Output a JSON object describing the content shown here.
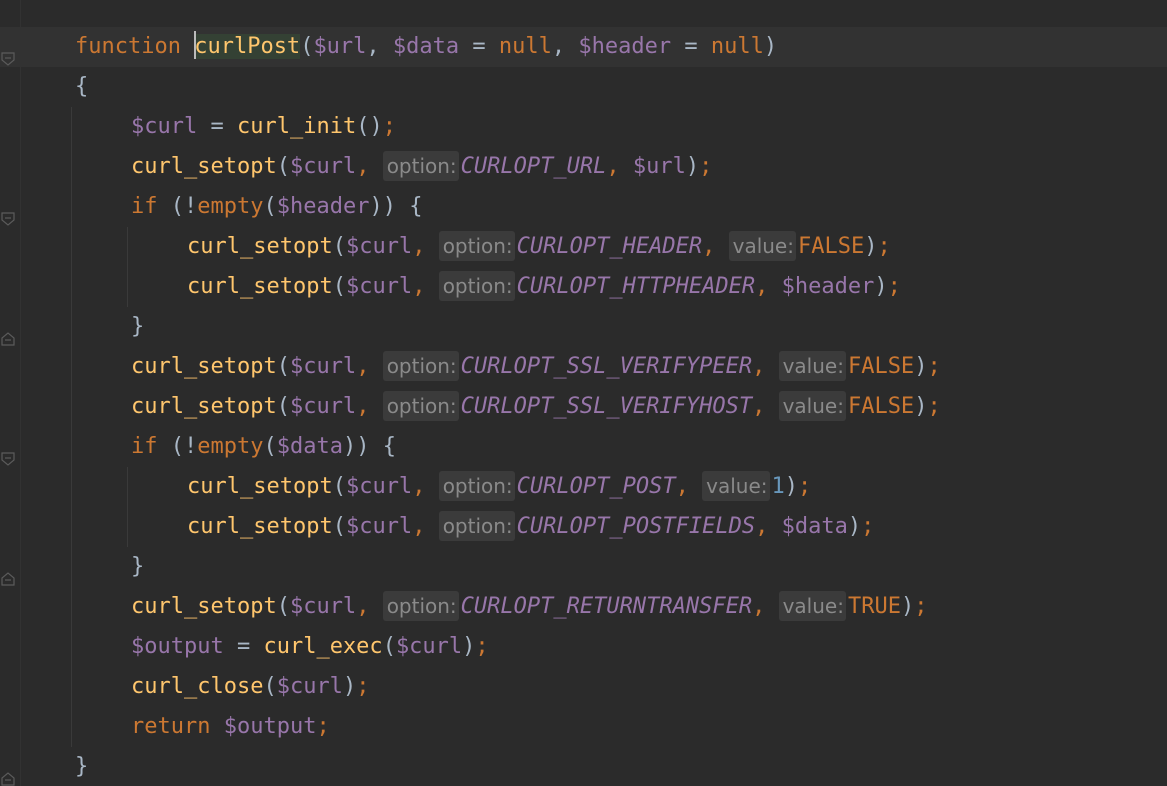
{
  "editor": {
    "lines": [
      {
        "indent": 0,
        "current": true,
        "tokens": [
          {
            "t": "kw",
            "v": "function "
          },
          {
            "t": "caret"
          },
          {
            "t": "fn",
            "v": "curlPost",
            "cls": "caret-word"
          },
          {
            "t": "txt",
            "v": "("
          },
          {
            "t": "var",
            "v": "$url"
          },
          {
            "t": "txt",
            "v": ", "
          },
          {
            "t": "var",
            "v": "$data"
          },
          {
            "t": "txt",
            "v": " = "
          },
          {
            "t": "kw",
            "v": "null"
          },
          {
            "t": "txt",
            "v": ", "
          },
          {
            "t": "var",
            "v": "$header"
          },
          {
            "t": "txt",
            "v": " = "
          },
          {
            "t": "kw",
            "v": "null"
          },
          {
            "t": "txt",
            "v": ")"
          }
        ]
      },
      {
        "indent": 0,
        "tokens": [
          {
            "t": "txt",
            "v": "{"
          }
        ]
      },
      {
        "indent": 1,
        "tokens": [
          {
            "t": "var",
            "v": "$curl"
          },
          {
            "t": "txt",
            "v": " = "
          },
          {
            "t": "fn",
            "v": "curl_init"
          },
          {
            "t": "txt",
            "v": "()"
          },
          {
            "t": "kw",
            "v": ";"
          }
        ]
      },
      {
        "indent": 1,
        "tokens": [
          {
            "t": "fn",
            "v": "curl_setopt"
          },
          {
            "t": "txt",
            "v": "("
          },
          {
            "t": "var",
            "v": "$curl"
          },
          {
            "t": "kw",
            "v": ", "
          },
          {
            "t": "hint",
            "v": "option:"
          },
          {
            "t": "const",
            "v": "CURLOPT_URL"
          },
          {
            "t": "kw",
            "v": ", "
          },
          {
            "t": "var",
            "v": "$url"
          },
          {
            "t": "txt",
            "v": ")"
          },
          {
            "t": "kw",
            "v": ";"
          }
        ]
      },
      {
        "indent": 1,
        "tokens": [
          {
            "t": "kw",
            "v": "if "
          },
          {
            "t": "txt",
            "v": "(!"
          },
          {
            "t": "kw",
            "v": "empty"
          },
          {
            "t": "txt",
            "v": "("
          },
          {
            "t": "var",
            "v": "$header"
          },
          {
            "t": "txt",
            "v": ")) {"
          }
        ]
      },
      {
        "indent": 2,
        "tokens": [
          {
            "t": "fn",
            "v": "curl_setopt"
          },
          {
            "t": "txt",
            "v": "("
          },
          {
            "t": "var",
            "v": "$curl"
          },
          {
            "t": "kw",
            "v": ", "
          },
          {
            "t": "hint",
            "v": "option:"
          },
          {
            "t": "const",
            "v": "CURLOPT_HEADER"
          },
          {
            "t": "kw",
            "v": ", "
          },
          {
            "t": "hint",
            "v": "value:"
          },
          {
            "t": "kw",
            "v": "FALSE"
          },
          {
            "t": "txt",
            "v": ")"
          },
          {
            "t": "kw",
            "v": ";"
          }
        ]
      },
      {
        "indent": 2,
        "tokens": [
          {
            "t": "fn",
            "v": "curl_setopt"
          },
          {
            "t": "txt",
            "v": "("
          },
          {
            "t": "var",
            "v": "$curl"
          },
          {
            "t": "kw",
            "v": ", "
          },
          {
            "t": "hint",
            "v": "option:"
          },
          {
            "t": "const",
            "v": "CURLOPT_HTTPHEADER"
          },
          {
            "t": "kw",
            "v": ", "
          },
          {
            "t": "var",
            "v": "$header"
          },
          {
            "t": "txt",
            "v": ")"
          },
          {
            "t": "kw",
            "v": ";"
          }
        ]
      },
      {
        "indent": 1,
        "tokens": [
          {
            "t": "txt",
            "v": "}"
          }
        ]
      },
      {
        "indent": 1,
        "tokens": [
          {
            "t": "fn",
            "v": "curl_setopt"
          },
          {
            "t": "txt",
            "v": "("
          },
          {
            "t": "var",
            "v": "$curl"
          },
          {
            "t": "kw",
            "v": ", "
          },
          {
            "t": "hint",
            "v": "option:"
          },
          {
            "t": "const",
            "v": "CURLOPT_SSL_VERIFYPEER"
          },
          {
            "t": "kw",
            "v": ", "
          },
          {
            "t": "hint",
            "v": "value:"
          },
          {
            "t": "kw",
            "v": "FALSE"
          },
          {
            "t": "txt",
            "v": ")"
          },
          {
            "t": "kw",
            "v": ";"
          }
        ]
      },
      {
        "indent": 1,
        "tokens": [
          {
            "t": "fn",
            "v": "curl_setopt"
          },
          {
            "t": "txt",
            "v": "("
          },
          {
            "t": "var",
            "v": "$curl"
          },
          {
            "t": "kw",
            "v": ", "
          },
          {
            "t": "hint",
            "v": "option:"
          },
          {
            "t": "const",
            "v": "CURLOPT_SSL_VERIFYHOST"
          },
          {
            "t": "kw",
            "v": ", "
          },
          {
            "t": "hint",
            "v": "value:"
          },
          {
            "t": "kw",
            "v": "FALSE"
          },
          {
            "t": "txt",
            "v": ")"
          },
          {
            "t": "kw",
            "v": ";"
          }
        ]
      },
      {
        "indent": 1,
        "tokens": [
          {
            "t": "kw",
            "v": "if "
          },
          {
            "t": "txt",
            "v": "(!"
          },
          {
            "t": "kw",
            "v": "empty"
          },
          {
            "t": "txt",
            "v": "("
          },
          {
            "t": "var",
            "v": "$data"
          },
          {
            "t": "txt",
            "v": ")) {"
          }
        ]
      },
      {
        "indent": 2,
        "tokens": [
          {
            "t": "fn",
            "v": "curl_setopt"
          },
          {
            "t": "txt",
            "v": "("
          },
          {
            "t": "var",
            "v": "$curl"
          },
          {
            "t": "kw",
            "v": ", "
          },
          {
            "t": "hint",
            "v": "option:"
          },
          {
            "t": "const",
            "v": "CURLOPT_POST"
          },
          {
            "t": "kw",
            "v": ", "
          },
          {
            "t": "hint",
            "v": "value:"
          },
          {
            "t": "num",
            "v": "1"
          },
          {
            "t": "txt",
            "v": ")"
          },
          {
            "t": "kw",
            "v": ";"
          }
        ]
      },
      {
        "indent": 2,
        "tokens": [
          {
            "t": "fn",
            "v": "curl_setopt"
          },
          {
            "t": "txt",
            "v": "("
          },
          {
            "t": "var",
            "v": "$curl"
          },
          {
            "t": "kw",
            "v": ", "
          },
          {
            "t": "hint",
            "v": "option:"
          },
          {
            "t": "const",
            "v": "CURLOPT_POSTFIELDS"
          },
          {
            "t": "kw",
            "v": ", "
          },
          {
            "t": "var",
            "v": "$data"
          },
          {
            "t": "txt",
            "v": ")"
          },
          {
            "t": "kw",
            "v": ";"
          }
        ]
      },
      {
        "indent": 1,
        "tokens": [
          {
            "t": "txt",
            "v": "}"
          }
        ]
      },
      {
        "indent": 1,
        "tokens": [
          {
            "t": "fn",
            "v": "curl_setopt"
          },
          {
            "t": "txt",
            "v": "("
          },
          {
            "t": "var",
            "v": "$curl"
          },
          {
            "t": "kw",
            "v": ", "
          },
          {
            "t": "hint",
            "v": "option:"
          },
          {
            "t": "const",
            "v": "CURLOPT_RETURNTRANSFER"
          },
          {
            "t": "kw",
            "v": ", "
          },
          {
            "t": "hint",
            "v": "value:"
          },
          {
            "t": "kw",
            "v": "TRUE"
          },
          {
            "t": "txt",
            "v": ")"
          },
          {
            "t": "kw",
            "v": ";"
          }
        ]
      },
      {
        "indent": 1,
        "tokens": [
          {
            "t": "var",
            "v": "$output"
          },
          {
            "t": "txt",
            "v": " = "
          },
          {
            "t": "fn",
            "v": "curl_exec"
          },
          {
            "t": "txt",
            "v": "("
          },
          {
            "t": "var",
            "v": "$curl"
          },
          {
            "t": "txt",
            "v": ")"
          },
          {
            "t": "kw",
            "v": ";"
          }
        ]
      },
      {
        "indent": 1,
        "tokens": [
          {
            "t": "fn",
            "v": "curl_close"
          },
          {
            "t": "txt",
            "v": "("
          },
          {
            "t": "var",
            "v": "$curl"
          },
          {
            "t": "txt",
            "v": ")"
          },
          {
            "t": "kw",
            "v": ";"
          }
        ]
      },
      {
        "indent": 1,
        "tokens": [
          {
            "t": "kw",
            "v": "return "
          },
          {
            "t": "var",
            "v": "$output"
          },
          {
            "t": "kw",
            "v": ";"
          }
        ]
      },
      {
        "indent": 0,
        "tokens": [
          {
            "t": "txt",
            "v": "}"
          }
        ]
      }
    ]
  },
  "colors": {
    "background": "#2b2b2b",
    "keyword": "#cc7832",
    "function": "#ffc66d",
    "variable": "#9876aa",
    "number": "#6897bb",
    "text": "#a9b7c6",
    "hint_bg": "#3b3b3b",
    "hint_text": "#8a8a8a"
  }
}
